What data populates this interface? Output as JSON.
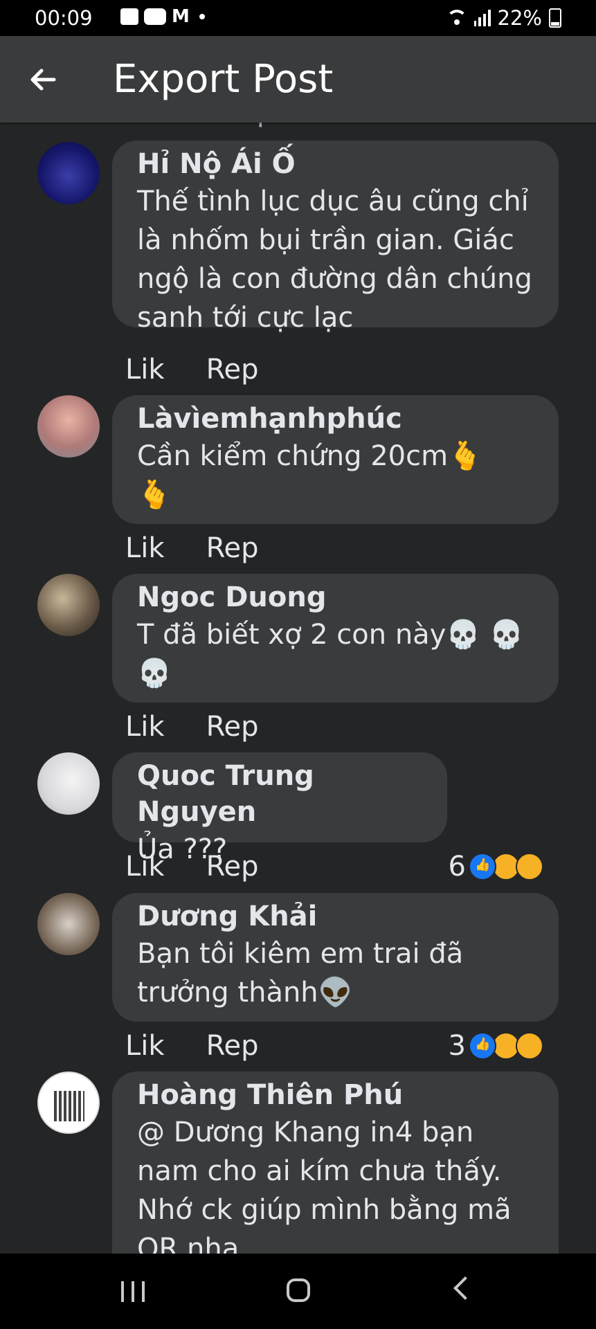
{
  "status_bar": {
    "time": "00:09",
    "battery": "22%"
  },
  "app_bar": {
    "title": "Export Post"
  },
  "actions": {
    "like": "Lik",
    "reply": "Rep"
  },
  "comments": [
    {
      "author": "Hỉ Nộ Ái Ố",
      "text": "Thế tình lục dục âu cũng chỉ là nhốm bụi trần gian. Giác ngộ là con đường dân chúng sanh tới cực lạc",
      "reaction_count": ""
    },
    {
      "author": "Làvìemhạnhphúc",
      "text": "Cần kiểm chứng 20cm🫰",
      "emoji_line": "🫰",
      "reaction_count": ""
    },
    {
      "author": "Ngoc Duong",
      "text": "T đã biết xợ 2 con này💀 💀",
      "emoji_line": "💀",
      "reaction_count": ""
    },
    {
      "author": "Quoc Trung Nguyen",
      "text": "Ủa ???",
      "reaction_count": "6"
    },
    {
      "author": "Dương Khải",
      "text": "Bạn tôi kiêm em trai đã trưởng thành👽",
      "reaction_count": "3"
    },
    {
      "author": "Hoàng Thiên Phú",
      "text": "@ Dương Khang in4 bạn nam cho ai kím chưa thấy. Nhớ ck giúp mình bằng mã QR nha",
      "reaction_count": ""
    }
  ],
  "colors": {
    "background": "#242526",
    "bubble": "#3a3b3c",
    "app_bar": "#3a3b3c",
    "like_blue": "#1877f2",
    "emoji_yellow": "#f7b125"
  }
}
